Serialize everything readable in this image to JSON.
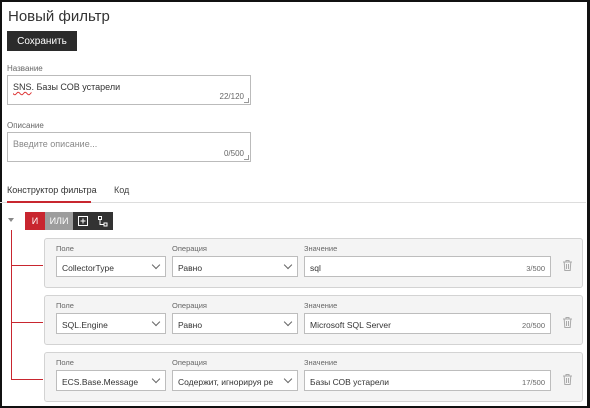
{
  "page": {
    "title": "Новый фильтр"
  },
  "toolbar": {
    "save_label": "Сохранить"
  },
  "name_field": {
    "label": "Название",
    "value_prefix": "SNS",
    "value_rest": ". Базы СОВ устарели",
    "counter": "22/120"
  },
  "description_field": {
    "label": "Описание",
    "placeholder": "Введите описание...",
    "counter": "0/500"
  },
  "tabs": [
    {
      "label": "Конструктор фильтра",
      "active": true
    },
    {
      "label": "Код",
      "active": false
    }
  ],
  "logic": {
    "and_label": "И",
    "or_label": "ИЛИ",
    "add_icon": "add-condition-icon",
    "group_icon": "add-group-icon"
  },
  "conditions": {
    "field_label": "Поле",
    "operation_label": "Операция",
    "value_label": "Значение",
    "rows": [
      {
        "field": "CollectorType",
        "operation": "Равно",
        "value": "sql",
        "counter": "3/500"
      },
      {
        "field": "SQL.Engine",
        "operation": "Равно",
        "value": "Microsoft SQL Server",
        "counter": "20/500"
      },
      {
        "field": "ECS.Base.Message",
        "operation": "Содержит, игнорируя ре",
        "value": "Базы СОВ устарели",
        "counter": "17/500"
      }
    ]
  },
  "colors": {
    "accent": "#c8262f",
    "dark": "#2b2b2b",
    "or_gray": "#9d9d9d"
  }
}
